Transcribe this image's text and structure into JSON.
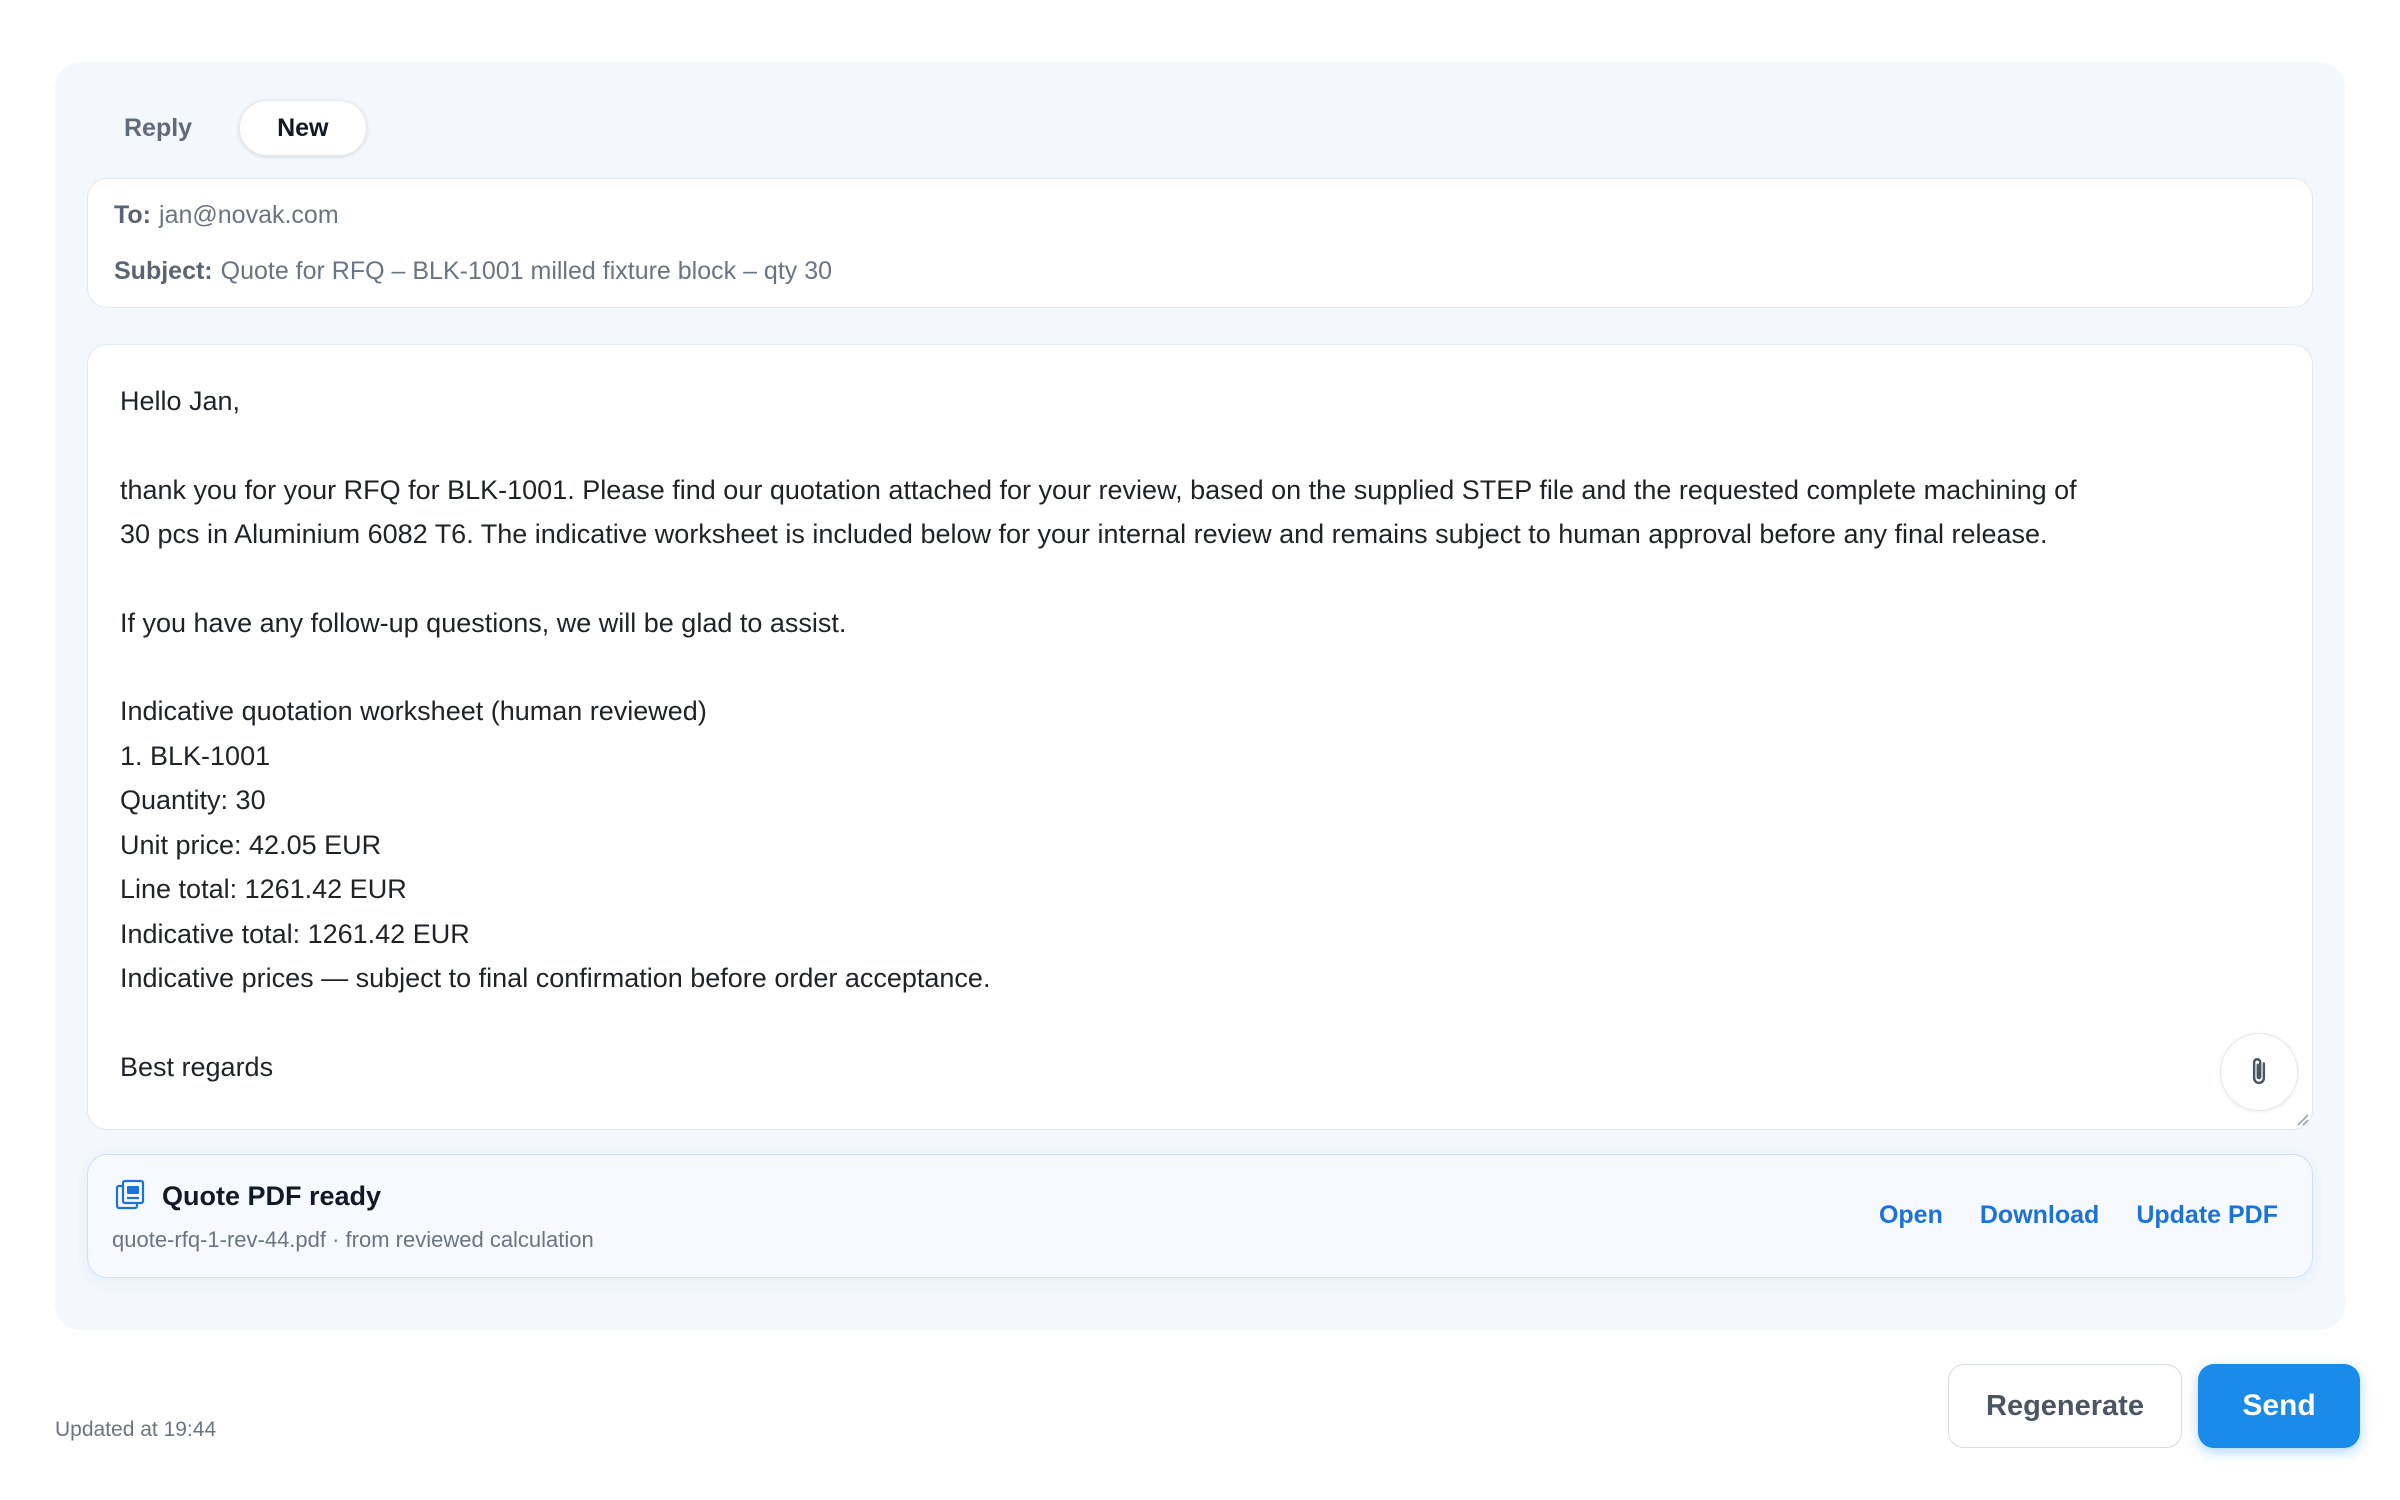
{
  "mode_tabs": [
    {
      "label": "Reply",
      "active": false
    },
    {
      "label": "New",
      "active": true
    }
  ],
  "header": {
    "to_label": "To:",
    "to_value": "jan@novak.com",
    "subject_label": "Subject:",
    "subject_value": "Quote for RFQ – BLK-1001 milled fixture block – qty 30"
  },
  "body": {
    "greeting": "Hello Jan,",
    "paragraph_1_line_1": "thank you for your RFQ for BLK-1001. Please find our quotation attached for your review, based on the supplied STEP file and the requested complete machining of",
    "paragraph_1_line_2": "30 pcs in Aluminium 6082 T6. The indicative worksheet is included below for your internal review and remains subject to human approval before any final release.",
    "paragraph_2": "If you have any follow-up questions, we will be glad to assist.",
    "worksheet": {
      "heading": "Indicative quotation worksheet (human reviewed)",
      "item": "1. BLK-1001",
      "quantity": "Quantity: 30",
      "unit_price": "Unit price: 42.05 EUR",
      "line_total": "Line total: 1261.42 EUR",
      "indicative_total": "Indicative total: 1261.42 EUR",
      "note": "Indicative prices — subject to final confirmation before order acceptance."
    },
    "closing": "Best regards"
  },
  "pdf": {
    "title": "Quote PDF ready",
    "subtitle": "quote-rfq-1-rev-44.pdf · from reviewed calculation",
    "actions": {
      "open": "Open",
      "download": "Download",
      "update": "Update PDF"
    }
  },
  "footer": {
    "updated": "Updated at 19:44",
    "regenerate_label": "Regenerate",
    "send_label": "Send"
  },
  "colors": {
    "accent": "#1a8be8",
    "link": "#1d72d8",
    "panel_bg": "#f4f7fb"
  },
  "icons": {
    "attach": "paperclip-icon",
    "pdf": "pdf-file-icon",
    "resize": "resize-handle-icon"
  }
}
